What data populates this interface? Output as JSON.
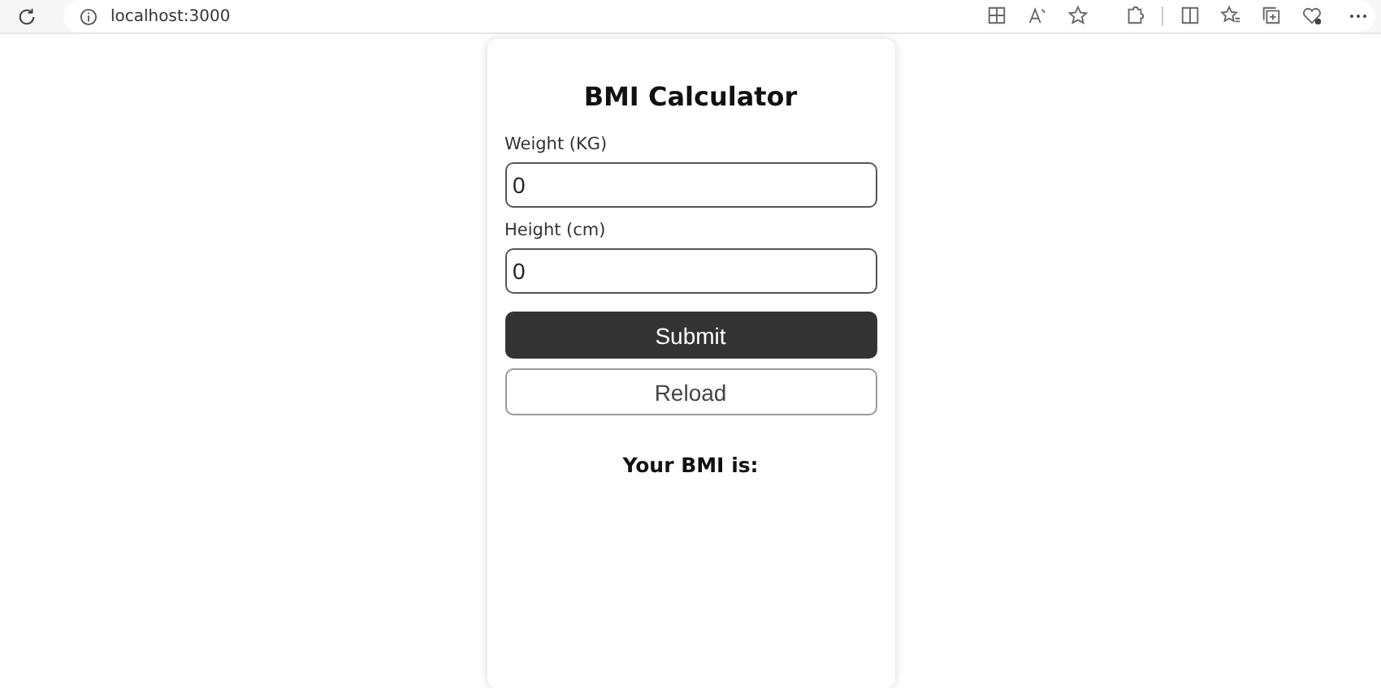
{
  "browser": {
    "url": "localhost:3000"
  },
  "form": {
    "title": "BMI Calculator",
    "fields": [
      {
        "label": "Weight (KG)",
        "value": "0"
      },
      {
        "label": "Height (cm)",
        "value": "0"
      }
    ],
    "buttons": [
      {
        "label": "Submit",
        "kind": "primary"
      },
      {
        "label": "Reload",
        "kind": "outline"
      }
    ],
    "result": "Your BMI is:"
  }
}
